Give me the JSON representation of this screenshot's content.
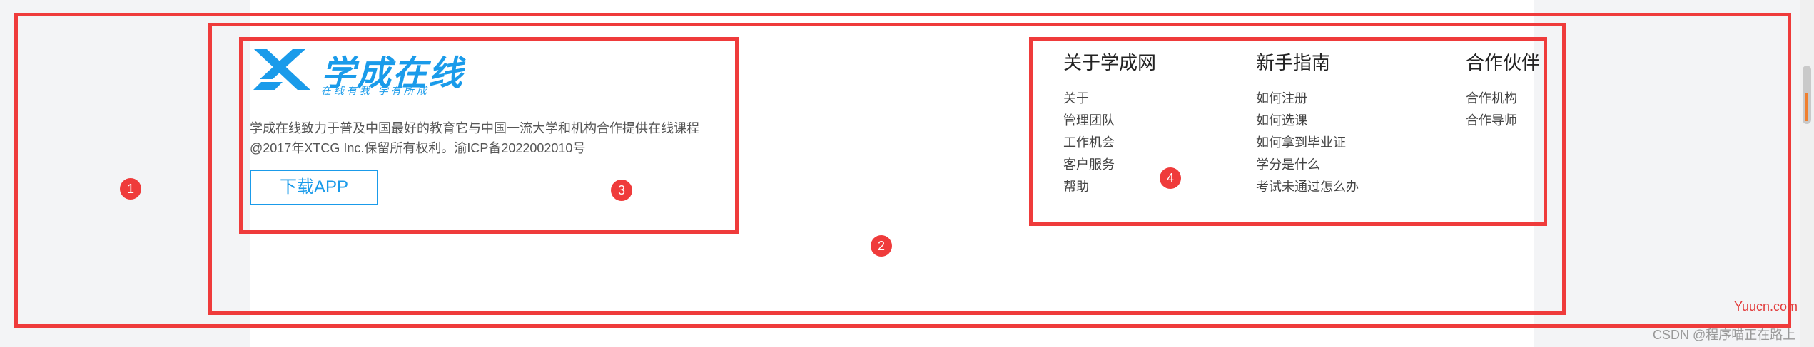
{
  "brand": {
    "name": "学成在线",
    "slogan": "在线有我  学有所成",
    "color": "#1a9bea"
  },
  "footer": {
    "description_line1": "学成在线致力于普及中国最好的教育它与中国一流大学和机构合作提供在线课程",
    "description_line2": "@2017年XTCG Inc.保留所有权利。渝ICP备2022002010号",
    "download_label": "下载APP"
  },
  "columns": [
    {
      "title": "关于学成网",
      "links": [
        "关于",
        "管理团队",
        "工作机会",
        "客户服务",
        "帮助"
      ]
    },
    {
      "title": "新手指南",
      "links": [
        "如何注册",
        "如何选课",
        "如何拿到毕业证",
        "学分是什么",
        "考试未通过怎么办"
      ]
    },
    {
      "title": "合作伙伴",
      "links": [
        "合作机构",
        "合作导师"
      ]
    }
  ],
  "annotations": {
    "badges": [
      "1",
      "2",
      "3",
      "4"
    ],
    "color": "#ef3b3b"
  },
  "watermarks": {
    "site": "Yuucn.com",
    "author": "CSDN @程序喵正在路上"
  }
}
